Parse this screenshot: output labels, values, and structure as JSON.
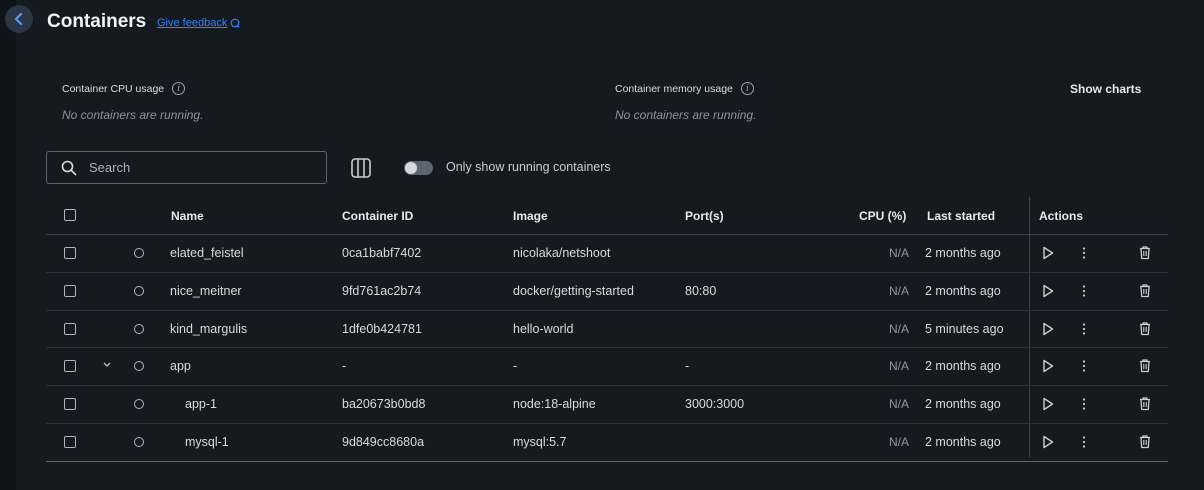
{
  "header": {
    "title": "Containers",
    "feedback_label": "Give feedback"
  },
  "stats": {
    "cpu_label": "Container CPU usage",
    "cpu_value": "No containers are running.",
    "memory_label": "Container memory usage",
    "memory_value": "No containers are running.",
    "show_charts_label": "Show charts"
  },
  "toolbar": {
    "search_placeholder": "Search",
    "search_value": "",
    "toggle_label": "Only show running containers",
    "toggle_on": false
  },
  "table": {
    "columns": {
      "name": "Name",
      "container_id": "Container ID",
      "image": "Image",
      "ports": "Port(s)",
      "cpu": "CPU (%)",
      "last_started": "Last started",
      "actions": "Actions"
    },
    "rows": [
      {
        "name": "elated_feistel",
        "id": "0ca1babf7402",
        "image": "nicolaka/netshoot",
        "ports": "",
        "cpu": "N/A",
        "last_started": "2 months ago"
      },
      {
        "name": "nice_meitner",
        "id": "9fd761ac2b74",
        "image": "docker/getting-started",
        "ports": "80:80",
        "cpu": "N/A",
        "last_started": "2 months ago"
      },
      {
        "name": "kind_margulis",
        "id": "1dfe0b424781",
        "image": "hello-world",
        "ports": "",
        "cpu": "N/A",
        "last_started": "5 minutes ago"
      },
      {
        "name": "app",
        "id": "-",
        "image": "-",
        "ports": "-",
        "cpu": "N/A",
        "last_started": "2 months ago"
      },
      {
        "name": "app-1",
        "id": "ba20673b0bd8",
        "image": "node:18-alpine",
        "ports": "3000:3000",
        "cpu": "N/A",
        "last_started": "2 months ago"
      },
      {
        "name": "mysql-1",
        "id": "9d849cc8680a",
        "image": "mysql:5.7",
        "ports": "",
        "cpu": "N/A",
        "last_started": "2 months ago"
      }
    ]
  },
  "colors": {
    "background": "#141a20",
    "accent": "#3b82f6"
  }
}
